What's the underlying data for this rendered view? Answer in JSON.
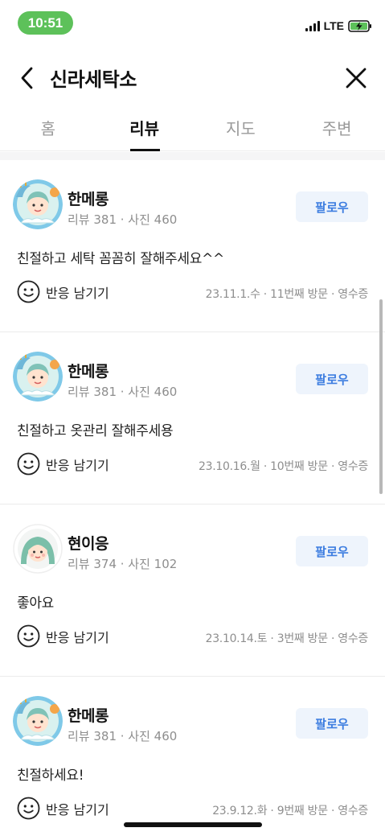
{
  "status_bar": {
    "time": "10:51",
    "network": "LTE",
    "time_pill_color": "#5dc15a",
    "battery_icon": "battery-charging-icon"
  },
  "header": {
    "title": "신라세탁소",
    "back_icon": "chevron-left-icon",
    "close_icon": "close-icon"
  },
  "tabs": [
    {
      "label": "홈",
      "active": false
    },
    {
      "label": "리뷰",
      "active": true
    },
    {
      "label": "지도",
      "active": false
    },
    {
      "label": "주변",
      "active": false
    }
  ],
  "follow_label": "팔로우",
  "react_label": "반응 남기기",
  "reviews": [
    {
      "name": "한메롱",
      "stats": "리뷰 381 · 사진 460",
      "text": "친절하고 세탁 꼼꼼히 잘해주세요^^",
      "meta": "23.11.1.수 · 11번째 방문 · 영수증",
      "avatar": "dragon-avatar"
    },
    {
      "name": "한메롱",
      "stats": "리뷰 381 · 사진 460",
      "text": "친절하고 옷관리 잘해주세용",
      "meta": "23.10.16.월 · 10번째 방문 · 영수증",
      "avatar": "dragon-avatar"
    },
    {
      "name": "현이응",
      "stats": "리뷰 374 · 사진 102",
      "text": "좋아요",
      "meta": "23.10.14.토 · 3번째 방문 · 영수증",
      "avatar": "girl-avatar"
    },
    {
      "name": "한메롱",
      "stats": "리뷰 381 · 사진 460",
      "text": "친절하세요!",
      "meta": "23.9.12.화 · 9번째 방문 · 영수증",
      "avatar": "dragon-avatar"
    }
  ],
  "colors": {
    "accent": "#3d7de0",
    "follow_bg": "#eef4fc"
  }
}
